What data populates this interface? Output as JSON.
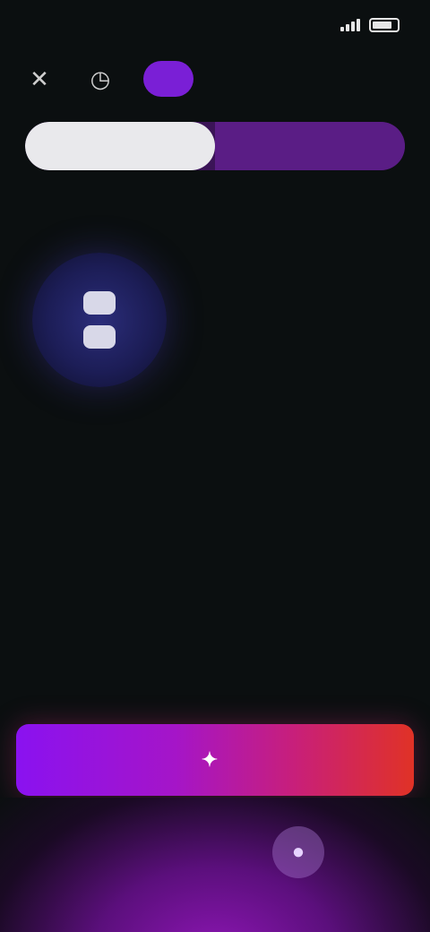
{
  "status_bar": {
    "time": "",
    "battery_icon": "battery-icon",
    "signal_icon": "signal-icon"
  },
  "top_nav": {
    "back_icon": "close-icon",
    "history_icon": "clock-icon",
    "pill_label": ""
  },
  "segment": {
    "option_active": "",
    "option_inactive": ""
  },
  "section": {
    "title": ""
  },
  "feature": {
    "orb_icon": "face-icon",
    "headline": "",
    "body": ""
  },
  "cta": {
    "label": "",
    "icon": "sparkle-icon"
  },
  "bottom": {
    "mic_icon": "mic-icon"
  },
  "colors": {
    "background": "#0b0f10",
    "accent_purple": "#7a1fd6",
    "cta_start": "#8a12f0",
    "cta_end": "#e03226"
  }
}
